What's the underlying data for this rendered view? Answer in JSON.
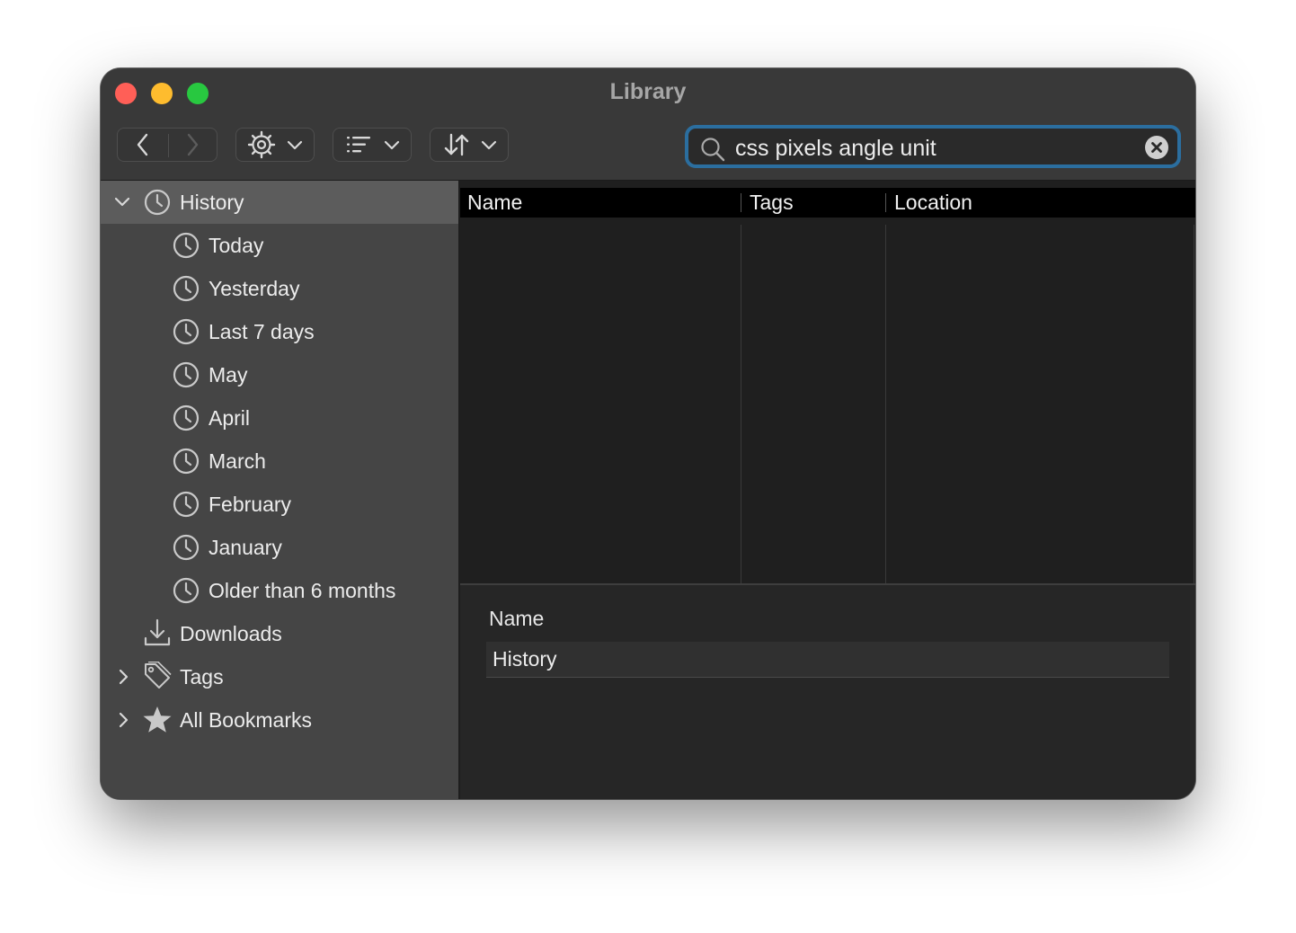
{
  "window": {
    "title": "Library"
  },
  "toolbar": {
    "back_icon": "chevron-left-icon",
    "forward_icon": "chevron-right-icon",
    "organize_icon": "gear-icon",
    "views_icon": "list-icon",
    "sort_icon": "sort-arrows-icon"
  },
  "search": {
    "value": "css pixels angle unit",
    "placeholder": "Search History",
    "focus_color": "#2b6e9f"
  },
  "sidebar": {
    "items": [
      {
        "label": "History",
        "icon": "clock-icon",
        "expanded": true,
        "selected": true
      },
      {
        "label": "Today",
        "icon": "clock-icon"
      },
      {
        "label": "Yesterday",
        "icon": "clock-icon"
      },
      {
        "label": "Last 7 days",
        "icon": "clock-icon"
      },
      {
        "label": "May",
        "icon": "clock-icon"
      },
      {
        "label": "April",
        "icon": "clock-icon"
      },
      {
        "label": "March",
        "icon": "clock-icon"
      },
      {
        "label": "February",
        "icon": "clock-icon"
      },
      {
        "label": "January",
        "icon": "clock-icon"
      },
      {
        "label": "Older than 6 months",
        "icon": "clock-icon"
      },
      {
        "label": "Downloads",
        "icon": "download-icon"
      },
      {
        "label": "Tags",
        "icon": "tag-icon",
        "expanded": false
      },
      {
        "label": "All Bookmarks",
        "icon": "star-icon",
        "expanded": false
      }
    ]
  },
  "table": {
    "columns": [
      "Name",
      "Tags",
      "Location"
    ],
    "rows": []
  },
  "details": {
    "name_label": "Name",
    "name_value": "History"
  },
  "colors": {
    "close": "#ff5f57",
    "minimize": "#febc2e",
    "maximize": "#28c840",
    "selection": "#5c5c5c"
  }
}
